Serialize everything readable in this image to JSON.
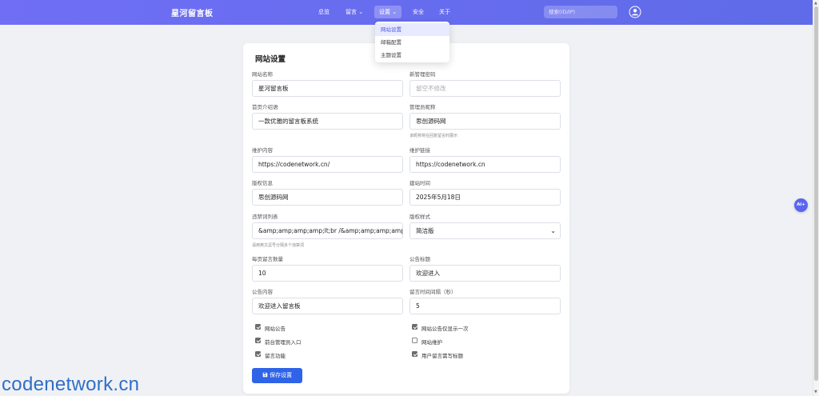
{
  "navbar": {
    "brand": "星河留言板",
    "items": [
      {
        "label": "总览"
      },
      {
        "label": "留言"
      },
      {
        "label": "设置"
      },
      {
        "label": "安全"
      },
      {
        "label": "关于"
      }
    ],
    "search_placeholder": "搜索(ID/IP)"
  },
  "dropdown": {
    "items": [
      {
        "label": "网站设置"
      },
      {
        "label": "邮箱配置"
      },
      {
        "label": "主题设置"
      }
    ]
  },
  "form": {
    "title": "网站设置",
    "site_name": {
      "label": "网站名称",
      "value": "星河留言板"
    },
    "admin_password": {
      "label": "新管理密码",
      "placeholder": "留空不修改"
    },
    "intro": {
      "label": "首页介绍语",
      "value": "一款优雅的留言板系统"
    },
    "admin_nickname": {
      "label": "管理员昵称",
      "value": "思创源码网",
      "help": "该昵称将在回复留言时展示"
    },
    "maint_content": {
      "label": "维护内容",
      "value": "https://codenetwork.cn/"
    },
    "maint_link": {
      "label": "维护链接",
      "value": "https://codenetwork.cn"
    },
    "copyright": {
      "label": "版权信息",
      "value": "思创源码网"
    },
    "build_date": {
      "label": "建站时间",
      "value": "2025年5月18日"
    },
    "banned_words": {
      "label": "违禁词列表",
      "value": "&amp;amp;amp;amp;lt;br /&amp;amp;amp;amp;",
      "help": "请用英文逗号分隔多个违禁词"
    },
    "copyright_style": {
      "label": "版权样式",
      "value": "简洁版"
    },
    "per_page": {
      "label": "每页留言数量",
      "value": "10"
    },
    "notice_title": {
      "label": "公告标题",
      "value": "欢迎进入"
    },
    "notice_content": {
      "label": "公告内容",
      "value": "欢迎进入留言板"
    },
    "interval": {
      "label": "留言时间间隔（秒）",
      "value": "5"
    },
    "checkboxes": [
      {
        "label": "网站公告",
        "checked": true
      },
      {
        "label": "网站公告仅显示一次",
        "checked": true
      },
      {
        "label": "前台管理员入口",
        "checked": true
      },
      {
        "label": "网站维护",
        "checked": false
      },
      {
        "label": "留言功能",
        "checked": true
      },
      {
        "label": "用户留言需写标题",
        "checked": true
      }
    ],
    "save_label": "保存设置"
  },
  "ai_badge": "Ai+",
  "watermark": "codenetwork.cn"
}
